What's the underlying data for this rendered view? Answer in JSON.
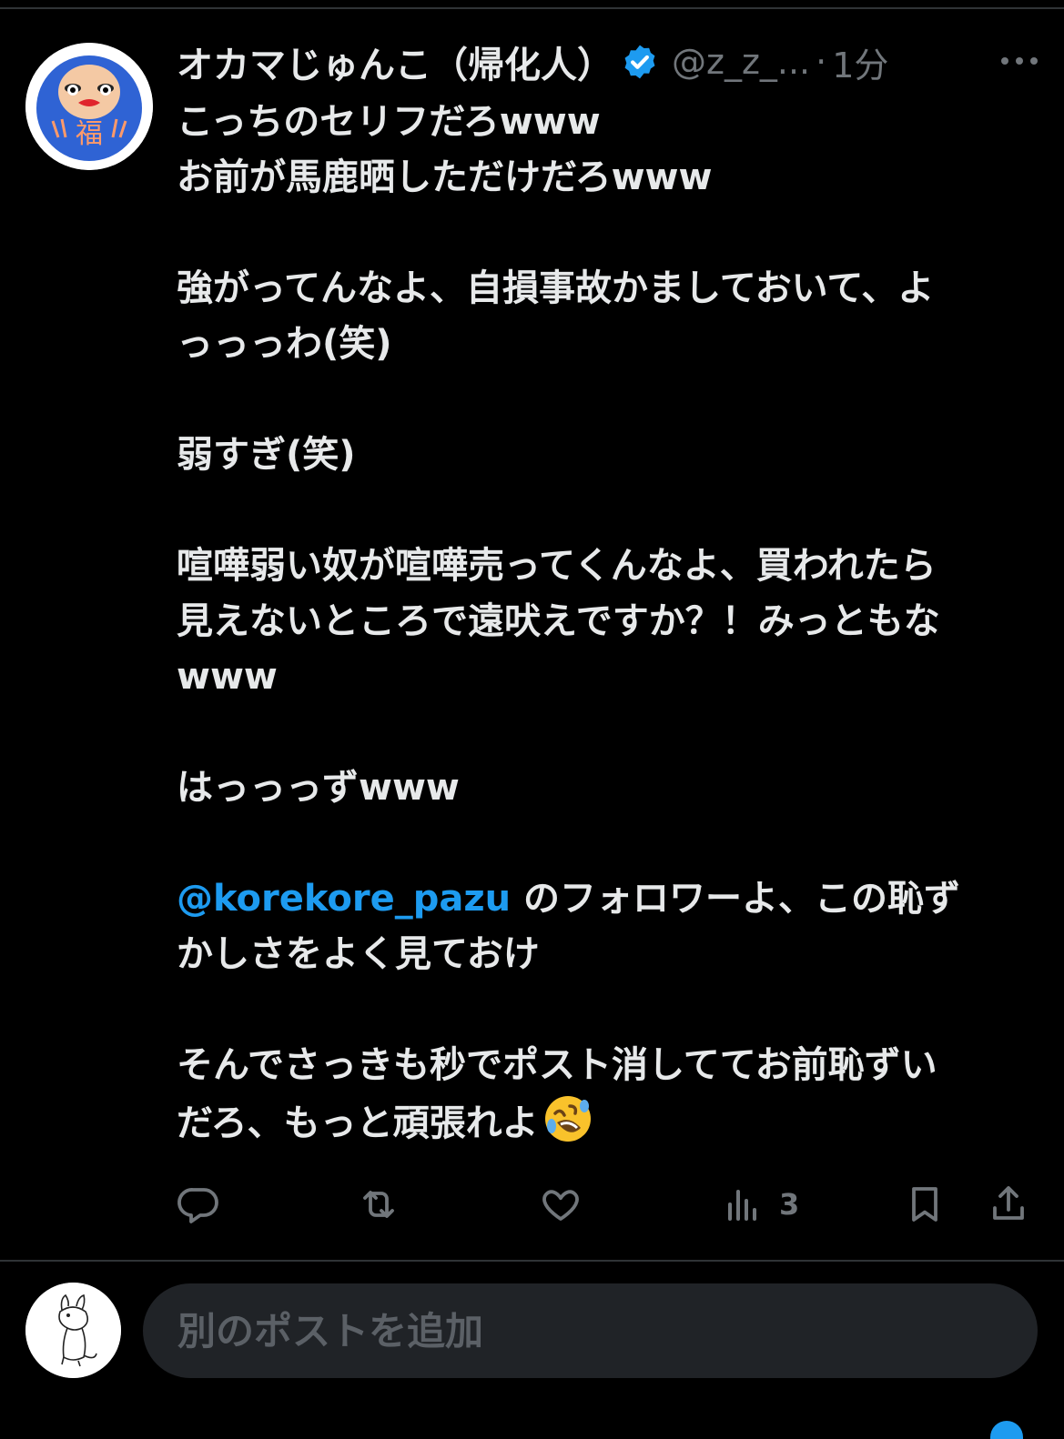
{
  "tweet": {
    "display_name": "オカマじゅんこ（帰化人）",
    "handle": "@z_z_...",
    "separator": "·",
    "time": "1分",
    "body": {
      "l1": "こっちのセリフだろwww",
      "l2": "お前が馬鹿晒しただけだろwww",
      "l3": "強がってんなよ、自損事故かましておいて、よ",
      "l4": "っっっわ(笑)",
      "l5": "弱すぎ(笑)",
      "l6": "喧嘩弱い奴が喧嘩売ってくんなよ、買われたら",
      "l7": "見えないところで遠吠えですか？！みっともな",
      "l8": "www",
      "l9": "はっっっずwww",
      "mention": "@korekore_pazu",
      "l10": " のフォロワーよ、この恥ず",
      "l11": "かしさをよく見ておけ",
      "l12": "そんでさっきも秒でポスト消しててお前恥ずい",
      "l13": "だろ、もっと頑張れよ"
    },
    "emoji": "rolling-on-floor-laughing",
    "views": "3",
    "avatar_text": "福"
  },
  "icons": {
    "verified": "verified-badge-icon",
    "more": "more-icon",
    "reply": "reply-icon",
    "retweet": "retweet-icon",
    "like": "like-icon",
    "views": "views-icon",
    "bookmark": "bookmark-icon",
    "share": "share-icon"
  },
  "compose": {
    "placeholder": "別のポストを追加"
  },
  "colors": {
    "background": "#000000",
    "text": "#e7e9ea",
    "secondary": "#71767b",
    "accent": "#1d9bf0",
    "input_bg": "#202327"
  }
}
